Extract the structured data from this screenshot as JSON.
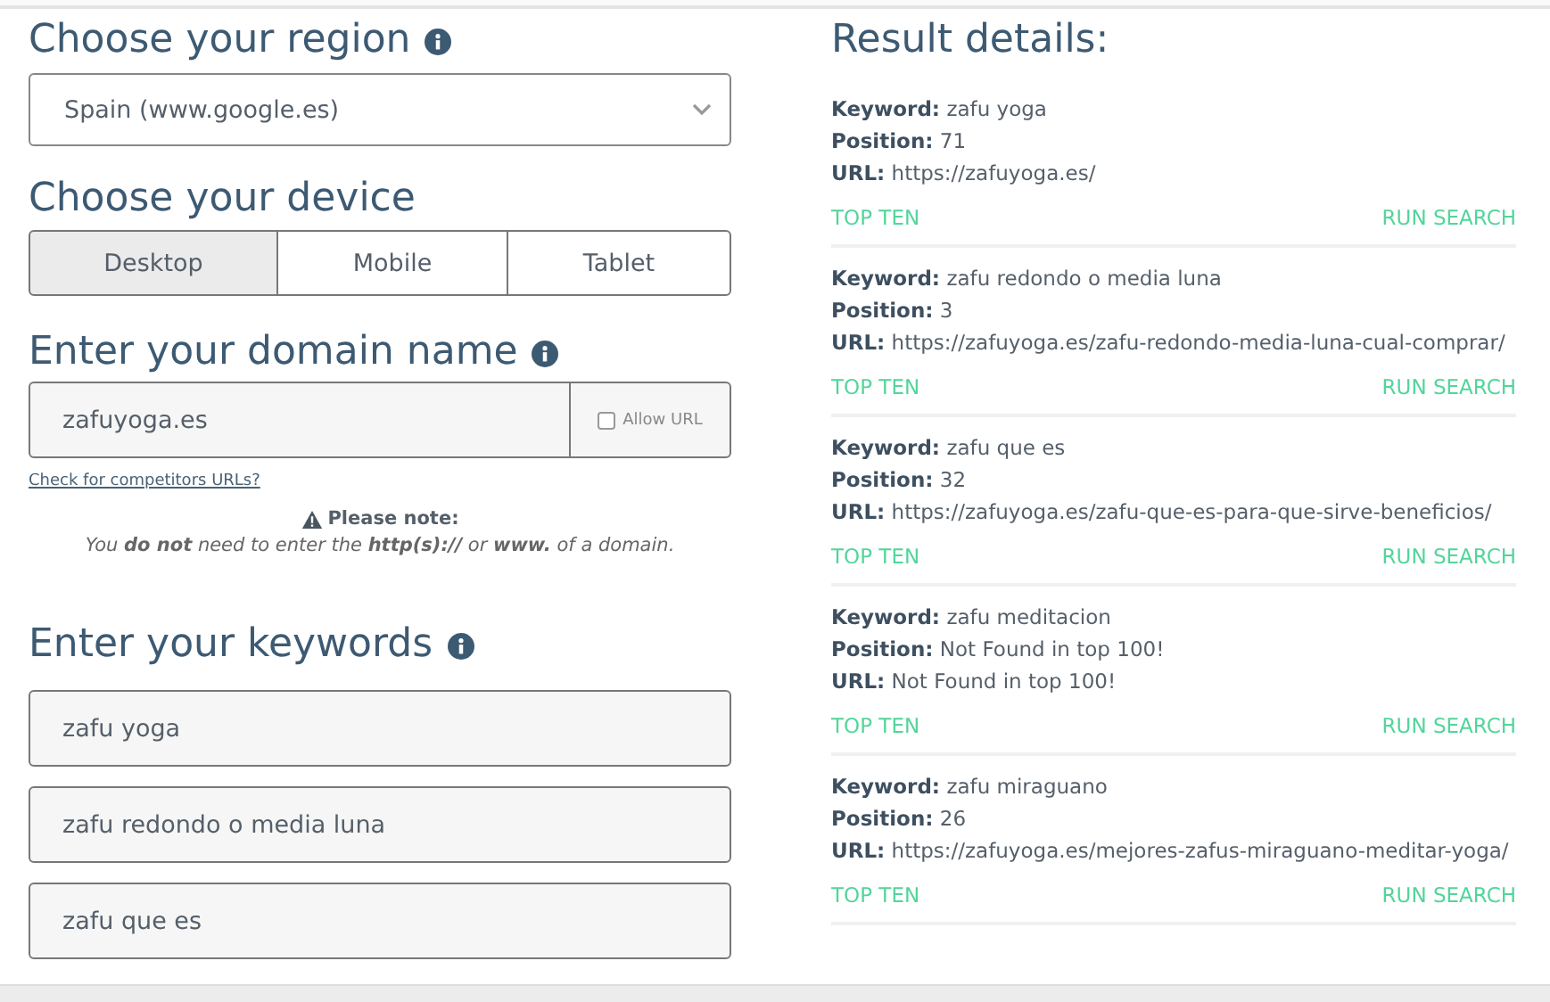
{
  "region": {
    "title": "Choose your region",
    "value": "Spain (www.google.es)"
  },
  "device": {
    "title": "Choose your device",
    "options": [
      {
        "label": "Desktop",
        "selected": true
      },
      {
        "label": "Mobile",
        "selected": false
      },
      {
        "label": "Tablet",
        "selected": false
      }
    ]
  },
  "domain": {
    "title": "Enter your domain name",
    "value": "zafuyoga.es",
    "allow_url": {
      "label": "Allow URL",
      "checked": false
    },
    "link": "Check for competitors URLs?",
    "note_title": "Please note:",
    "note": "You **do not** need to enter the **http(s)://** or **www.** of a domain."
  },
  "keywords": {
    "title": "Enter your keywords",
    "fields": [
      {
        "value": "zafu yoga"
      },
      {
        "value": "zafu redondo o media luna"
      },
      {
        "value": "zafu que es"
      }
    ]
  },
  "results": {
    "title": "Result details:",
    "items": [
      {
        "lines": [
          "**Keyword:** zafu yoga",
          "**Position:** 71",
          "**URL:** https://zafuyoga.es/"
        ],
        "actions": [
          "TOP TEN",
          "RUN SEARCH"
        ]
      },
      {
        "lines": [
          "**Keyword:** zafu redondo o media luna",
          "**Position:** 3",
          "**URL:** https://zafuyoga.es/zafu-redondo-media-luna-cual-comprar/"
        ],
        "actions": [
          "TOP TEN",
          "RUN SEARCH"
        ]
      },
      {
        "lines": [
          "**Keyword:** zafu que es",
          "**Position:** 32",
          "**URL:** https://zafuyoga.es/zafu-que-es-para-que-sirve-beneficios/"
        ],
        "actions": [
          "TOP TEN",
          "RUN SEARCH"
        ]
      },
      {
        "lines": [
          "**Keyword:** zafu meditacion",
          "**Position:** Not Found in top 100!",
          "**URL:** Not Found in top 100!"
        ],
        "actions": [
          "TOP TEN",
          "RUN SEARCH"
        ]
      },
      {
        "lines": [
          "**Keyword:** zafu miraguano",
          "**Position:** 26",
          "**URL:** https://zafuyoga.es/mejores-zafus-miraguano-meditar-yoga/"
        ],
        "actions": [
          "TOP TEN",
          "RUN SEARCH"
        ]
      }
    ]
  }
}
